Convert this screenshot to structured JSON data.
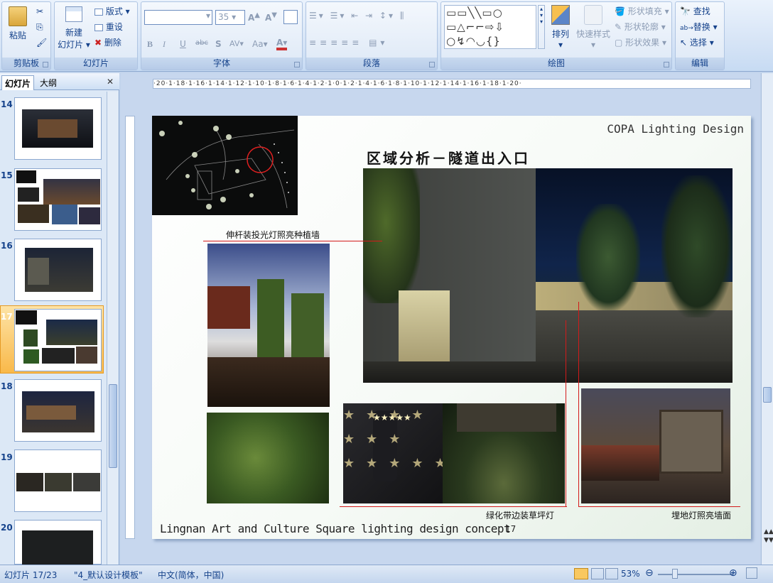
{
  "ribbon": {
    "clipboard": {
      "label": "剪贴板",
      "paste": "粘贴"
    },
    "slides": {
      "label": "幻灯片",
      "new_slide": "新建",
      "new_slide2": "幻灯片",
      "layout": "版式",
      "reset": "重设",
      "delete": "删除"
    },
    "font": {
      "label": "字体",
      "size": "35",
      "bold": "B",
      "italic": "I",
      "underline": "U",
      "strike": "abc",
      "shadow": "S",
      "spacing": "AV",
      "case": "Aa",
      "color": "A"
    },
    "paragraph": {
      "label": "段落"
    },
    "drawing": {
      "label": "绘图",
      "arrange": "排列",
      "quick_styles": "快速样式",
      "shape_fill": "形状填充",
      "shape_outline": "形状轮廓",
      "shape_effects": "形状效果"
    },
    "editing": {
      "label": "编辑",
      "find": "查找",
      "replace": "替换",
      "select": "选择"
    }
  },
  "sidebar": {
    "tab_slides": "幻灯片",
    "tab_outline": "大纲",
    "close": "✕",
    "thumbs": [
      {
        "num": "14"
      },
      {
        "num": "15"
      },
      {
        "num": "16"
      },
      {
        "num": "17"
      },
      {
        "num": "18"
      },
      {
        "num": "19"
      },
      {
        "num": "20"
      }
    ]
  },
  "ruler": {
    "h": "·20·1·18·1·16·1·14·1·12·1·10·1·8·1·6·1·4·1·2·1·0·1·2·1·4·1·6·1·8·1·10·1·12·1·14·1·16·1·18·1·20·"
  },
  "slide": {
    "brand": "COPA Lighting Design",
    "title": "区域分析－隧道出入口",
    "callout_pole": "伸杆装投光灯照亮种植墙",
    "callout_lawn": "绿化带边装草坪灯",
    "callout_ground": "埋地灯照亮墙面",
    "footer": "Lingnan Art and Culture Square lighting design concept",
    "page": "17"
  },
  "status": {
    "slide_pos": "幻灯片 17/23",
    "template": "\"4_默认设计模板\"",
    "language": "中文(简体，中国)",
    "zoom": "53%"
  },
  "colors": {
    "accent": "#d31a1a",
    "ribbon": "#dce8f6",
    "selected_thumb": "#f9b94a"
  }
}
